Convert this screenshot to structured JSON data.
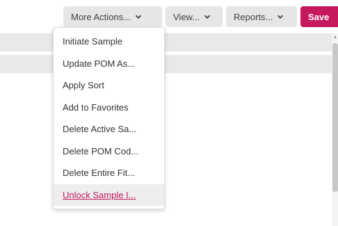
{
  "toolbar": {
    "more_actions_label": "More Actions...",
    "view_label": "View...",
    "reports_label": "Reports...",
    "save_label": "Save"
  },
  "menu": {
    "items": [
      {
        "label": "Initiate Sample"
      },
      {
        "label": "Update POM As..."
      },
      {
        "label": "Apply Sort"
      },
      {
        "label": "Add to Favorites"
      },
      {
        "label": "Delete Active Sa..."
      },
      {
        "label": "Delete POM Cod..."
      },
      {
        "label": "Delete Entire Fit..."
      },
      {
        "label": "Unlock Sample I...",
        "active": true
      }
    ]
  },
  "colors": {
    "accent": "#c5185d",
    "button_bg": "#e6e6e6",
    "band_bg": "#e9e9e9"
  },
  "icons": {
    "dropdown": "chevron-down-icon",
    "scroll": "scroll-up-arrow-icon"
  }
}
